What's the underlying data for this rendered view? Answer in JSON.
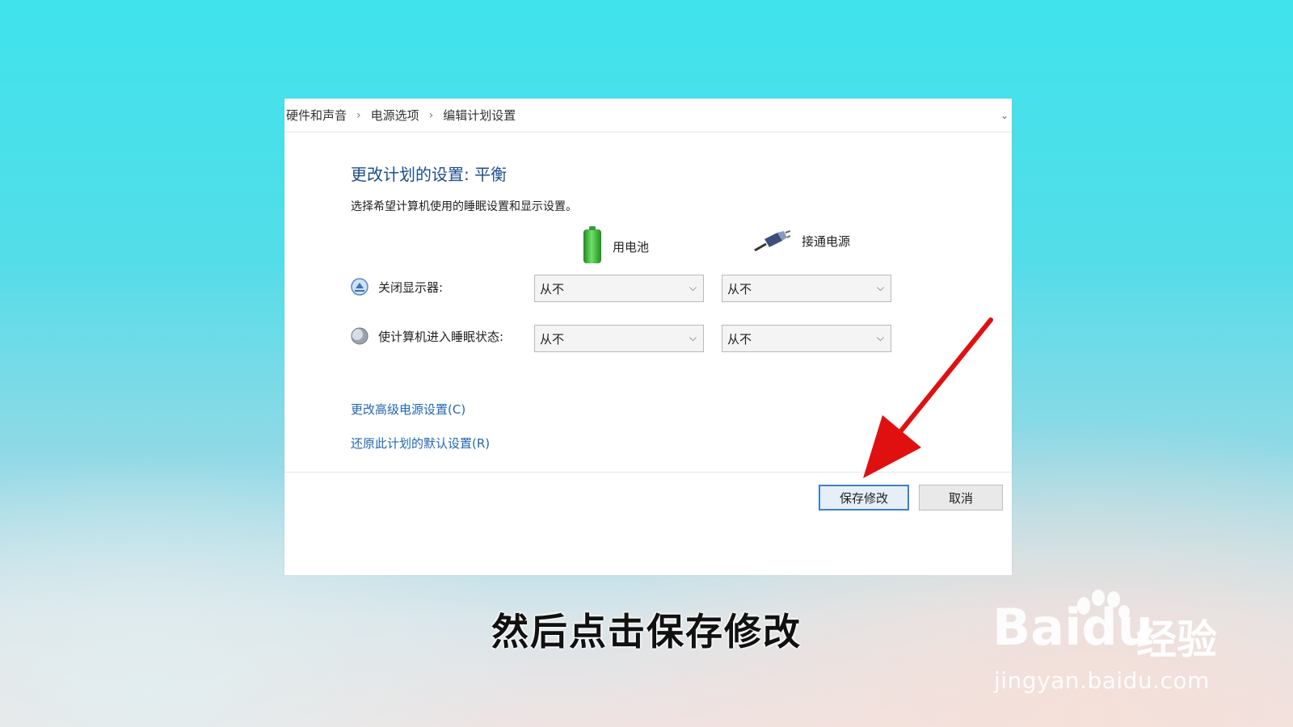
{
  "breadcrumb": {
    "items": [
      "硬件和声音",
      "电源选项",
      "编辑计划设置"
    ],
    "separator": "›"
  },
  "plan": {
    "title": "更改计划的设置: 平衡",
    "description": "选择希望计算机使用的睡眠设置和显示设置。"
  },
  "columns": {
    "battery": "用电池",
    "plugged_in": "接通电源"
  },
  "settings": [
    {
      "label": "关闭显示器:",
      "battery_value": "从不",
      "plugged_value": "从不",
      "icon": "display-icon"
    },
    {
      "label": "使计算机进入睡眠状态:",
      "battery_value": "从不",
      "plugged_value": "从不",
      "icon": "sleep-moon-icon"
    }
  ],
  "links": {
    "advanced": "更改高级电源设置(C)",
    "restore": "还原此计划的默认设置(R)"
  },
  "buttons": {
    "save": "保存修改",
    "cancel": "取消"
  },
  "caption": "然后点击保存修改",
  "watermark": {
    "logo_text": "Bai",
    "logo_du": "du",
    "brand_cn": "经验",
    "url": "jingyan.baidu.com"
  },
  "colors": {
    "link": "#2266b3",
    "title": "#1e4e8c",
    "arrow": "#e01010",
    "save_border": "#3c7fc8"
  }
}
